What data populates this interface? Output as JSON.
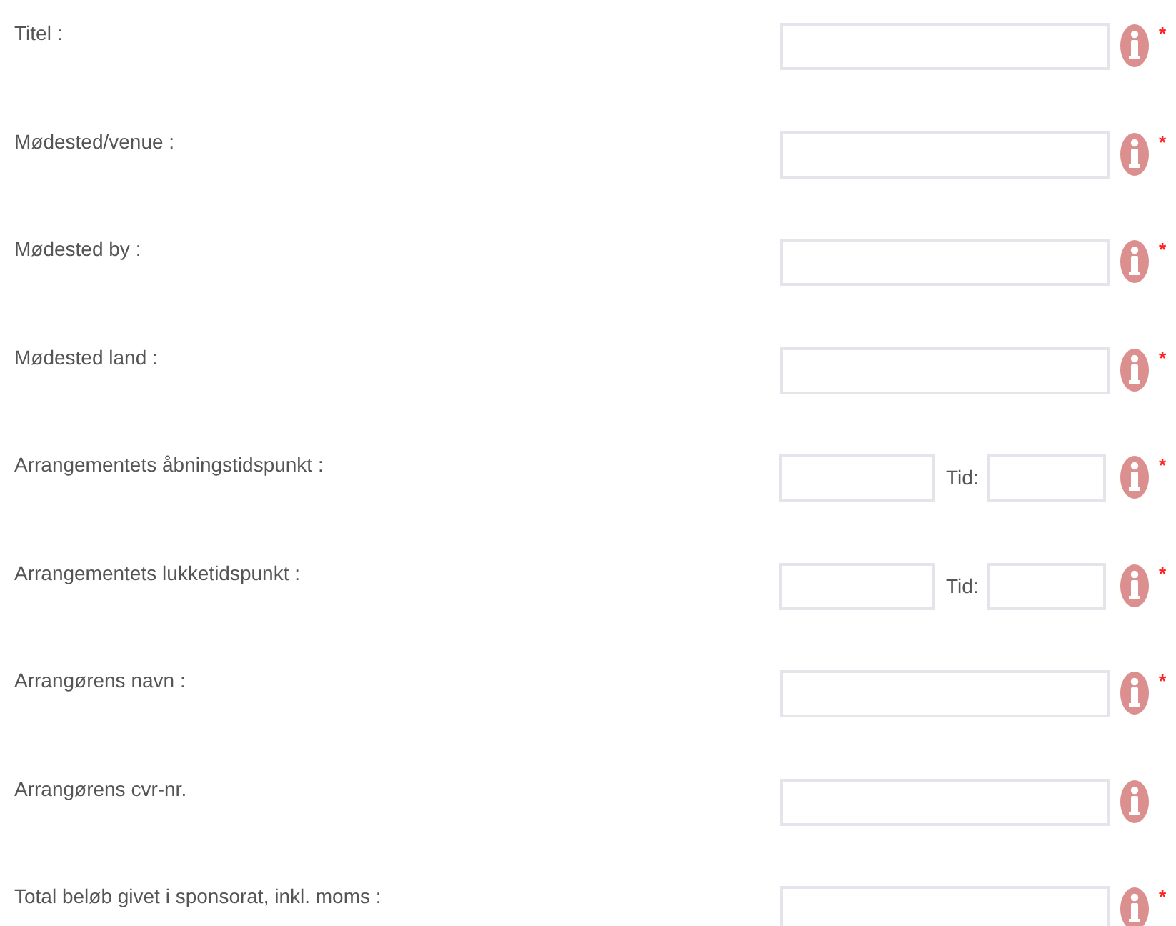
{
  "required_mark": "*",
  "fields": [
    {
      "kind": "text",
      "label": "Titel :",
      "required": true
    },
    {
      "kind": "text",
      "label": "Mødested/venue :",
      "required": true
    },
    {
      "kind": "text",
      "label": "Mødested by :",
      "required": true
    },
    {
      "kind": "text",
      "label": "Mødested land :",
      "required": true
    },
    {
      "kind": "datetime",
      "label": "Arrangementets åbningstidspunkt :",
      "time_label": "Tid:",
      "required": true
    },
    {
      "kind": "datetime",
      "label": "Arrangementets lukketidspunkt :",
      "time_label": "Tid:",
      "required": true
    },
    {
      "kind": "text",
      "label": "Arrangørens navn :",
      "required": true
    },
    {
      "kind": "text",
      "label": "Arrangørens cvr-nr.",
      "required": false
    },
    {
      "kind": "text",
      "label": "Total beløb givet i sponsorat, inkl. moms :",
      "required": true
    }
  ]
}
